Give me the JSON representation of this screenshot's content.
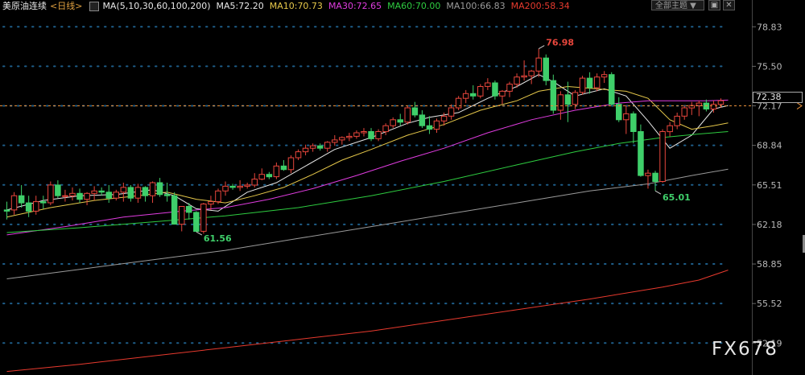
{
  "header": {
    "instrument": "美原油连续",
    "period": "<日线>",
    "ma_params": "MA(5,10,30,60,100,200)",
    "ma_values": [
      {
        "label": "MA5:72.20",
        "color": "#e6e6e6"
      },
      {
        "label": "MA10:70.73",
        "color": "#e6c84a"
      },
      {
        "label": "MA30:72.65",
        "color": "#e03ce0"
      },
      {
        "label": "MA60:70.00",
        "color": "#2ecc40"
      },
      {
        "label": "MA100:66.83",
        "color": "#9a9a9a"
      },
      {
        "label": "MA200:58.34",
        "color": "#e83a2e"
      }
    ],
    "subject_select": "全部主题",
    "btn_restore": "▣",
    "btn_close": "✕"
  },
  "price_tag": "72.38",
  "watermark": "FX678",
  "colors": {
    "background": "#000000",
    "up": "#e8463c",
    "down": "#3fcf6a",
    "grid_dot": "#1e5e8a",
    "ref_line": "#e8903a",
    "axis_text": "#b8b8b8"
  },
  "chart_data": {
    "type": "candlestick",
    "ylim": [
      49.5,
      80.0
    ],
    "yticks": [
      "78.83",
      "75.50",
      "72.17",
      "68.84",
      "65.51",
      "62.18",
      "58.85",
      "55.52",
      "52.19"
    ],
    "ref_price": 72.17,
    "annotations": [
      {
        "text": "76.98",
        "index": 73,
        "price": 76.98,
        "color": "#e8463c",
        "pos": "above"
      },
      {
        "text": "61.56",
        "index": 26,
        "price": 61.56,
        "color": "#3fcf6a",
        "pos": "below"
      },
      {
        "text": "65.01",
        "index": 89,
        "price": 65.01,
        "color": "#3fcf6a",
        "pos": "below"
      }
    ],
    "ohlc": [
      [
        63.4,
        64.1,
        62.6,
        63.3
      ],
      [
        63.4,
        64.9,
        63.0,
        64.6
      ],
      [
        64.6,
        65.5,
        63.6,
        64.0
      ],
      [
        64.0,
        64.6,
        62.8,
        63.3
      ],
      [
        63.3,
        64.6,
        63.0,
        64.1
      ],
      [
        64.1,
        64.6,
        63.5,
        64.0
      ],
      [
        64.0,
        65.8,
        63.8,
        65.5
      ],
      [
        65.5,
        65.9,
        64.4,
        64.6
      ],
      [
        64.6,
        65.1,
        64.1,
        64.6
      ],
      [
        64.6,
        65.3,
        64.2,
        64.8
      ],
      [
        64.8,
        65.2,
        64.0,
        64.3
      ],
      [
        64.3,
        64.9,
        63.8,
        64.8
      ],
      [
        64.8,
        65.4,
        64.2,
        65.0
      ],
      [
        65.0,
        65.3,
        64.6,
        64.9
      ],
      [
        64.9,
        65.5,
        64.0,
        64.4
      ],
      [
        64.4,
        65.1,
        64.2,
        64.9
      ],
      [
        64.9,
        65.7,
        64.1,
        65.3
      ],
      [
        65.3,
        65.5,
        64.1,
        64.4
      ],
      [
        64.4,
        65.6,
        64.0,
        65.3
      ],
      [
        65.3,
        65.4,
        64.1,
        64.6
      ],
      [
        64.6,
        65.8,
        64.0,
        65.7
      ],
      [
        65.7,
        66.1,
        64.5,
        64.7
      ],
      [
        64.7,
        65.7,
        64.1,
        64.6
      ],
      [
        64.6,
        64.9,
        62.2,
        62.2
      ],
      [
        62.2,
        62.8,
        61.6,
        63.7
      ],
      [
        63.7,
        64.0,
        62.6,
        63.2
      ],
      [
        63.2,
        63.3,
        61.56,
        61.6
      ],
      [
        61.6,
        64.0,
        61.4,
        63.9
      ],
      [
        63.9,
        64.6,
        63.4,
        64.1
      ],
      [
        64.1,
        65.2,
        63.9,
        65.0
      ],
      [
        65.0,
        65.8,
        64.6,
        65.4
      ],
      [
        65.4,
        65.6,
        65.1,
        65.3
      ],
      [
        65.3,
        65.9,
        65.0,
        65.4
      ],
      [
        65.4,
        65.7,
        65.2,
        65.5
      ],
      [
        65.5,
        66.5,
        65.3,
        66.0
      ],
      [
        66.0,
        66.9,
        65.9,
        66.4
      ],
      [
        66.4,
        66.6,
        66.0,
        66.2
      ],
      [
        66.2,
        67.4,
        66.0,
        67.1
      ],
      [
        67.1,
        67.6,
        66.7,
        66.8
      ],
      [
        66.8,
        68.0,
        66.5,
        67.8
      ],
      [
        67.8,
        68.5,
        67.6,
        68.3
      ],
      [
        68.3,
        68.9,
        68.0,
        68.6
      ],
      [
        68.6,
        69.0,
        68.3,
        68.8
      ],
      [
        68.8,
        69.0,
        68.4,
        68.6
      ],
      [
        68.6,
        69.2,
        68.3,
        69.1
      ],
      [
        69.1,
        69.7,
        68.8,
        69.3
      ],
      [
        69.3,
        69.6,
        68.9,
        69.5
      ],
      [
        69.5,
        69.9,
        69.2,
        69.6
      ],
      [
        69.6,
        70.1,
        69.4,
        69.9
      ],
      [
        69.9,
        70.3,
        69.6,
        70.0
      ],
      [
        70.0,
        70.3,
        69.2,
        69.4
      ],
      [
        69.4,
        70.2,
        69.2,
        70.0
      ],
      [
        70.0,
        70.7,
        69.7,
        70.5
      ],
      [
        70.5,
        71.2,
        70.3,
        71.0
      ],
      [
        71.0,
        71.5,
        70.5,
        70.8
      ],
      [
        70.8,
        72.2,
        70.6,
        72.0
      ],
      [
        72.0,
        72.5,
        71.2,
        71.4
      ],
      [
        71.4,
        71.8,
        70.3,
        70.5
      ],
      [
        70.5,
        71.3,
        69.8,
        70.2
      ],
      [
        70.2,
        71.1,
        69.9,
        70.9
      ],
      [
        70.9,
        71.6,
        70.5,
        71.3
      ],
      [
        71.3,
        72.3,
        71.0,
        72.0
      ],
      [
        72.0,
        73.0,
        71.8,
        72.8
      ],
      [
        72.8,
        73.5,
        72.4,
        73.2
      ],
      [
        73.2,
        73.9,
        72.7,
        73.0
      ],
      [
        73.0,
        74.0,
        72.8,
        73.8
      ],
      [
        73.8,
        74.5,
        73.5,
        74.1
      ],
      [
        74.1,
        74.3,
        72.7,
        73.0
      ],
      [
        73.0,
        73.5,
        72.3,
        73.4
      ],
      [
        73.4,
        74.2,
        72.9,
        74.0
      ],
      [
        74.0,
        74.9,
        73.7,
        74.6
      ],
      [
        74.6,
        76.0,
        74.3,
        74.7
      ],
      [
        74.7,
        75.2,
        74.0,
        75.1
      ],
      [
        75.1,
        76.98,
        74.6,
        76.2
      ],
      [
        76.2,
        76.5,
        73.9,
        74.3
      ],
      [
        74.3,
        74.8,
        71.5,
        71.8
      ],
      [
        71.8,
        73.4,
        71.0,
        73.1
      ],
      [
        73.1,
        74.2,
        70.8,
        72.3
      ],
      [
        72.3,
        73.5,
        71.9,
        73.3
      ],
      [
        73.3,
        74.7,
        73.1,
        74.5
      ],
      [
        74.5,
        75.0,
        73.2,
        73.7
      ],
      [
        73.7,
        74.9,
        73.4,
        74.6
      ],
      [
        74.6,
        75.1,
        74.1,
        74.8
      ],
      [
        74.8,
        75.0,
        72.2,
        72.3
      ],
      [
        72.3,
        72.9,
        70.8,
        71.0
      ],
      [
        71.0,
        72.2,
        69.8,
        71.5
      ],
      [
        71.5,
        71.7,
        69.0,
        70.0
      ],
      [
        70.0,
        70.6,
        66.2,
        66.3
      ],
      [
        66.3,
        66.8,
        65.2,
        66.5
      ],
      [
        66.5,
        66.7,
        65.01,
        65.8
      ],
      [
        65.8,
        70.2,
        65.7,
        70.0
      ],
      [
        70.0,
        70.8,
        69.6,
        70.5
      ],
      [
        70.5,
        71.6,
        70.2,
        71.3
      ],
      [
        71.3,
        72.2,
        71.0,
        72.0
      ],
      [
        72.0,
        72.5,
        71.4,
        72.2
      ],
      [
        72.2,
        72.6,
        71.3,
        72.4
      ],
      [
        72.4,
        72.7,
        71.7,
        71.9
      ],
      [
        71.9,
        72.6,
        71.6,
        72.3
      ],
      [
        72.3,
        72.8,
        72.0,
        72.6
      ]
    ],
    "series": [
      {
        "name": "MA5",
        "color": "#e6e6e6",
        "values": [
          [
            0,
            63.4
          ],
          [
            5,
            64.2
          ],
          [
            10,
            64.6
          ],
          [
            15,
            64.7
          ],
          [
            20,
            65.1
          ],
          [
            23,
            64.6
          ],
          [
            26,
            63.5
          ],
          [
            29,
            63.3
          ],
          [
            33,
            64.9
          ],
          [
            37,
            65.7
          ],
          [
            41,
            67.1
          ],
          [
            45,
            68.5
          ],
          [
            50,
            69.5
          ],
          [
            55,
            70.7
          ],
          [
            58,
            71.2
          ],
          [
            62,
            71.6
          ],
          [
            66,
            72.8
          ],
          [
            70,
            73.8
          ],
          [
            73,
            74.8
          ],
          [
            75,
            74.2
          ],
          [
            78,
            73.0
          ],
          [
            82,
            73.6
          ],
          [
            85,
            73.0
          ],
          [
            88,
            70.9
          ],
          [
            91,
            68.6
          ],
          [
            94,
            69.7
          ],
          [
            97,
            71.9
          ],
          [
            99,
            72.2
          ]
        ]
      },
      {
        "name": "MA10",
        "color": "#e6c84a",
        "values": [
          [
            0,
            62.8
          ],
          [
            6,
            63.6
          ],
          [
            12,
            64.2
          ],
          [
            18,
            64.6
          ],
          [
            22,
            64.9
          ],
          [
            26,
            64.3
          ],
          [
            30,
            64.0
          ],
          [
            34,
            64.6
          ],
          [
            38,
            65.3
          ],
          [
            42,
            66.4
          ],
          [
            46,
            67.6
          ],
          [
            50,
            68.5
          ],
          [
            55,
            69.7
          ],
          [
            60,
            70.6
          ],
          [
            65,
            71.8
          ],
          [
            70,
            72.6
          ],
          [
            73,
            73.4
          ],
          [
            77,
            73.8
          ],
          [
            81,
            73.6
          ],
          [
            85,
            73.4
          ],
          [
            88,
            72.8
          ],
          [
            91,
            71.0
          ],
          [
            94,
            70.2
          ],
          [
            97,
            70.5
          ],
          [
            99,
            70.73
          ]
        ]
      },
      {
        "name": "MA30",
        "color": "#e03ce0",
        "values": [
          [
            0,
            61.3
          ],
          [
            8,
            62.0
          ],
          [
            16,
            62.8
          ],
          [
            24,
            63.3
          ],
          [
            30,
            63.6
          ],
          [
            36,
            64.3
          ],
          [
            42,
            65.2
          ],
          [
            48,
            66.3
          ],
          [
            54,
            67.5
          ],
          [
            60,
            68.6
          ],
          [
            66,
            69.9
          ],
          [
            72,
            71.0
          ],
          [
            78,
            71.8
          ],
          [
            84,
            72.4
          ],
          [
            88,
            72.6
          ],
          [
            92,
            72.6
          ],
          [
            96,
            72.6
          ],
          [
            99,
            72.65
          ]
        ]
      },
      {
        "name": "MA60",
        "color": "#2ecc40",
        "values": [
          [
            0,
            61.5
          ],
          [
            10,
            61.9
          ],
          [
            20,
            62.4
          ],
          [
            30,
            62.9
          ],
          [
            40,
            63.6
          ],
          [
            50,
            64.6
          ],
          [
            60,
            65.8
          ],
          [
            70,
            67.2
          ],
          [
            78,
            68.3
          ],
          [
            84,
            69.0
          ],
          [
            90,
            69.5
          ],
          [
            95,
            69.8
          ],
          [
            99,
            70.0
          ]
        ]
      },
      {
        "name": "MA100",
        "color": "#9a9a9a",
        "values": [
          [
            0,
            57.6
          ],
          [
            10,
            58.4
          ],
          [
            20,
            59.2
          ],
          [
            30,
            60.0
          ],
          [
            40,
            61.0
          ],
          [
            50,
            62.0
          ],
          [
            60,
            63.0
          ],
          [
            70,
            64.0
          ],
          [
            80,
            65.0
          ],
          [
            88,
            65.6
          ],
          [
            94,
            66.3
          ],
          [
            99,
            66.83
          ]
        ]
      },
      {
        "name": "MA200",
        "color": "#e83a2e",
        "values": [
          [
            0,
            49.8
          ],
          [
            10,
            50.4
          ],
          [
            20,
            51.1
          ],
          [
            30,
            51.8
          ],
          [
            40,
            52.5
          ],
          [
            50,
            53.2
          ],
          [
            60,
            54.1
          ],
          [
            70,
            55.0
          ],
          [
            80,
            55.9
          ],
          [
            90,
            56.9
          ],
          [
            95,
            57.5
          ],
          [
            99,
            58.34
          ]
        ]
      }
    ]
  }
}
